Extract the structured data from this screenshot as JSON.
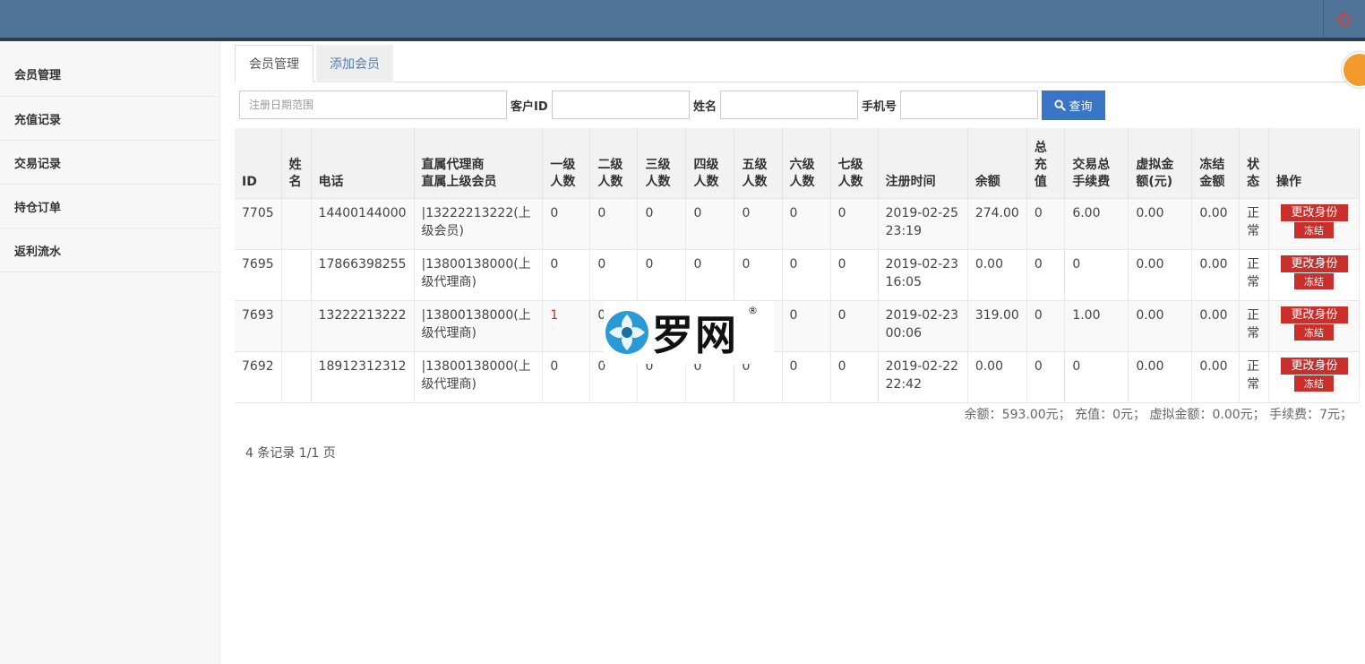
{
  "sidebar": {
    "items": [
      {
        "label": "会员管理"
      },
      {
        "label": "充值记录"
      },
      {
        "label": "交易记录"
      },
      {
        "label": "持仓订单"
      },
      {
        "label": "返利流水"
      }
    ]
  },
  "tabs": [
    {
      "label": "会员管理",
      "active": true
    },
    {
      "label": "添加会员",
      "active": false
    }
  ],
  "search": {
    "date_placeholder": "注册日期范围",
    "customer_id_label": "客户ID",
    "name_label": "姓名",
    "phone_label": "手机号",
    "query_label": "查询"
  },
  "table": {
    "headers": {
      "id": "ID",
      "name": "姓名",
      "phone": "电话",
      "agent_line1": "直属代理商",
      "agent_line2": "直属上级会员",
      "l1": "一级人数",
      "l2": "二级人数",
      "l3": "三级人数",
      "l4": "四级人数",
      "l5": "五级人数",
      "l6": "六级人数",
      "l7": "七级人数",
      "reg_time": "注册时间",
      "balance": "余额",
      "total_recharge": "总充值",
      "fee": "交易总手续费",
      "virtual": "虚拟金额(元)",
      "frozen": "冻结金额",
      "status": "状态",
      "ops": "操作"
    },
    "rows": [
      {
        "id": "7705",
        "name": "",
        "phone": "14400144000",
        "agent": "|13222213222(上级会员)",
        "l1": "0",
        "l2": "0",
        "l3": "0",
        "l4": "0",
        "l5": "0",
        "l6": "0",
        "l7": "0",
        "reg_time": "2019-02-25 23:19",
        "balance": "274.00",
        "total_recharge": "0",
        "fee": "6.00",
        "virtual": "0.00",
        "frozen": "0.00",
        "status": "正常",
        "btn_change": "更改身份",
        "btn_freeze": "冻结"
      },
      {
        "id": "7695",
        "name": "",
        "phone": "17866398255",
        "agent": "|13800138000(上级代理商)",
        "l1": "0",
        "l2": "0",
        "l3": "0",
        "l4": "0",
        "l5": "0",
        "l6": "0",
        "l7": "0",
        "reg_time": "2019-02-23 16:05",
        "balance": "0.00",
        "total_recharge": "0",
        "fee": "0",
        "virtual": "0.00",
        "frozen": "0.00",
        "status": "正常",
        "btn_change": "更改身份",
        "btn_freeze": "冻结"
      },
      {
        "id": "7693",
        "name": "",
        "phone": "13222213222",
        "agent": "|13800138000(上级代理商)",
        "l1": "1",
        "l2": "0",
        "l3": "0",
        "l4": "0",
        "l5": "0",
        "l6": "0",
        "l7": "0",
        "reg_time": "2019-02-23 00:06",
        "balance": "319.00",
        "total_recharge": "0",
        "fee": "1.00",
        "virtual": "0.00",
        "frozen": "0.00",
        "status": "正常",
        "btn_change": "更改身份",
        "btn_freeze": "冻结"
      },
      {
        "id": "7692",
        "name": "",
        "phone": "18912312312",
        "agent": "|13800138000(上级代理商)",
        "l1": "0",
        "l2": "0",
        "l3": "0",
        "l4": "0",
        "l5": "0",
        "l6": "0",
        "l7": "0",
        "reg_time": "2019-02-22 22:42",
        "balance": "0.00",
        "total_recharge": "0",
        "fee": "0",
        "virtual": "0.00",
        "frozen": "0.00",
        "status": "正常",
        "btn_change": "更改身份",
        "btn_freeze": "冻结"
      }
    ]
  },
  "summary": "余额：593.00元； 充值：0元； 虚拟金额：0.00元； 手续费：7元；",
  "paging": "4 条记录 1/1 页",
  "watermark": {
    "text": "罗网",
    "reg": "®"
  },
  "colors": {
    "topbar": "#4f7498",
    "primary": "#3a74c4",
    "danger": "#c9302c",
    "highlight": "#d12d2d"
  }
}
